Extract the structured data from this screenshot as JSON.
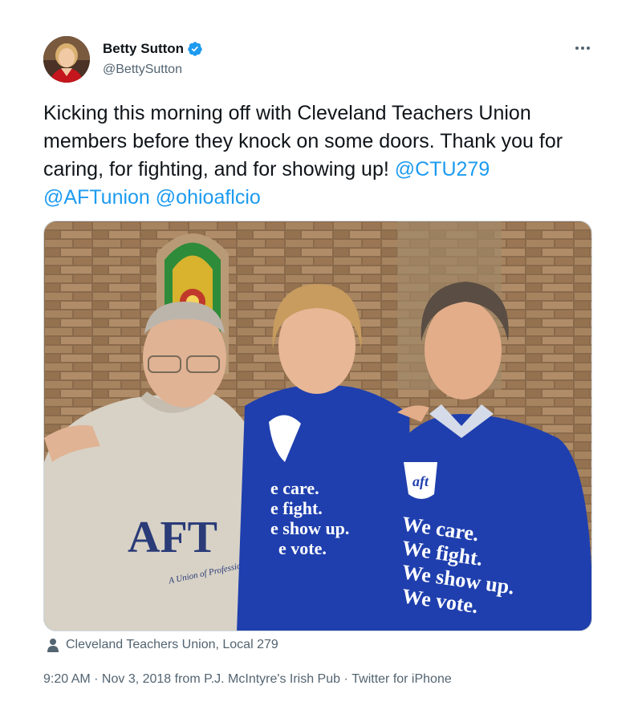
{
  "author": {
    "display_name": "Betty Sutton",
    "handle": "@BettySutton"
  },
  "more_label": "More",
  "tweet": {
    "text_plain": "Kicking this morning off with Cleveland Teachers Union members before they knock on some doors. Thank you for caring, for fighting, and for showing up! ",
    "mentions": [
      "@CTU279",
      "@AFTunion",
      "@ohioaflcio"
    ]
  },
  "photo": {
    "sweatshirt_logo": "AFT",
    "sweatshirt_tagline": "A Union of Professionals",
    "shirt_center_lines": [
      "e care.",
      "e fight.",
      "e show up.",
      "e vote."
    ],
    "shirt_right_lines": [
      "We care.",
      "We fight.",
      "We show up.",
      "We vote."
    ],
    "shirt_logo": "aft"
  },
  "location": {
    "label": "Cleveland Teachers Union, Local 279"
  },
  "meta": {
    "time": "9:20 AM",
    "separator": " · ",
    "date": "Nov 3, 2018",
    "from_text": " from P.J. McIntyre's Irish Pub",
    "client": "Twitter for iPhone"
  },
  "colors": {
    "link": "#1d9bf0",
    "secondary_text": "#536471",
    "verified": "#1d9bf0"
  }
}
